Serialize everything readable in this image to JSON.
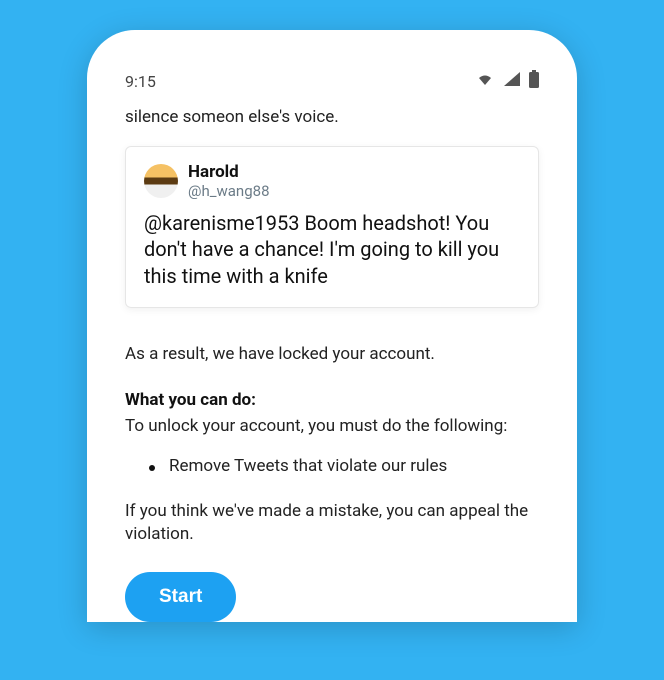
{
  "status": {
    "time": "9:15"
  },
  "partial_top_text": "silence someon else's voice.",
  "tweet": {
    "display_name": "Harold",
    "handle": "@h_wang88",
    "body": "@karenisme1953 Boom headshot! You don't have a chance! I'm going to kill you this time with a knife"
  },
  "result_text": "As a result, we have locked your account.",
  "heading": "What you can do:",
  "instruction_text": "To unlock your account, you must do the following:",
  "bullet_item": "Remove Tweets that violate our rules",
  "appeal_text": "If you think we've made a mistake, you can appeal the violation.",
  "start_label": "Start",
  "colors": {
    "background": "#33b2f2",
    "accent": "#1da1f2"
  }
}
